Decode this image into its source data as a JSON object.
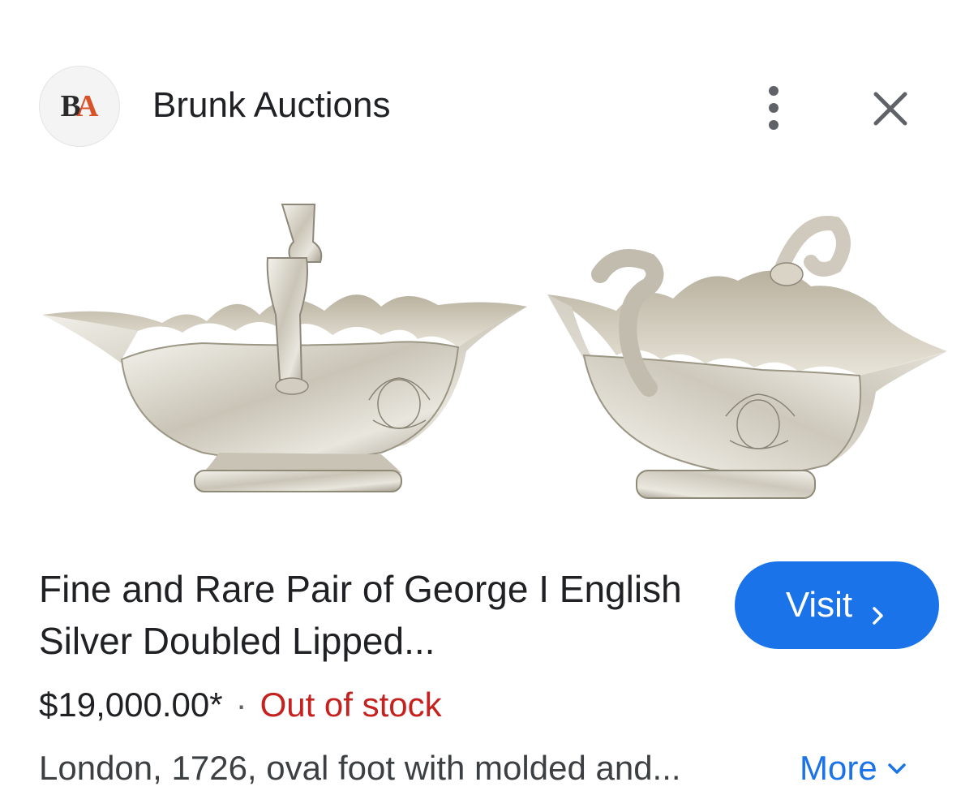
{
  "header": {
    "logo_text_b": "B",
    "logo_text_a": "A",
    "source_name": "Brunk Auctions",
    "menu_icon": "more-vert-icon",
    "close_icon": "close-icon"
  },
  "product": {
    "title": "Fine and Rare Pair of George I English Silver Doubled Lipped...",
    "visit_label": "Visit",
    "price": "$19,000.00*",
    "separator": "·",
    "stock_status": "Out of stock",
    "description": "London, 1726, oval foot with molded and...",
    "more_label": "More"
  },
  "colors": {
    "accent": "#1a73e8",
    "out_of_stock": "#c5221f",
    "logo_accent": "#d9532a"
  }
}
